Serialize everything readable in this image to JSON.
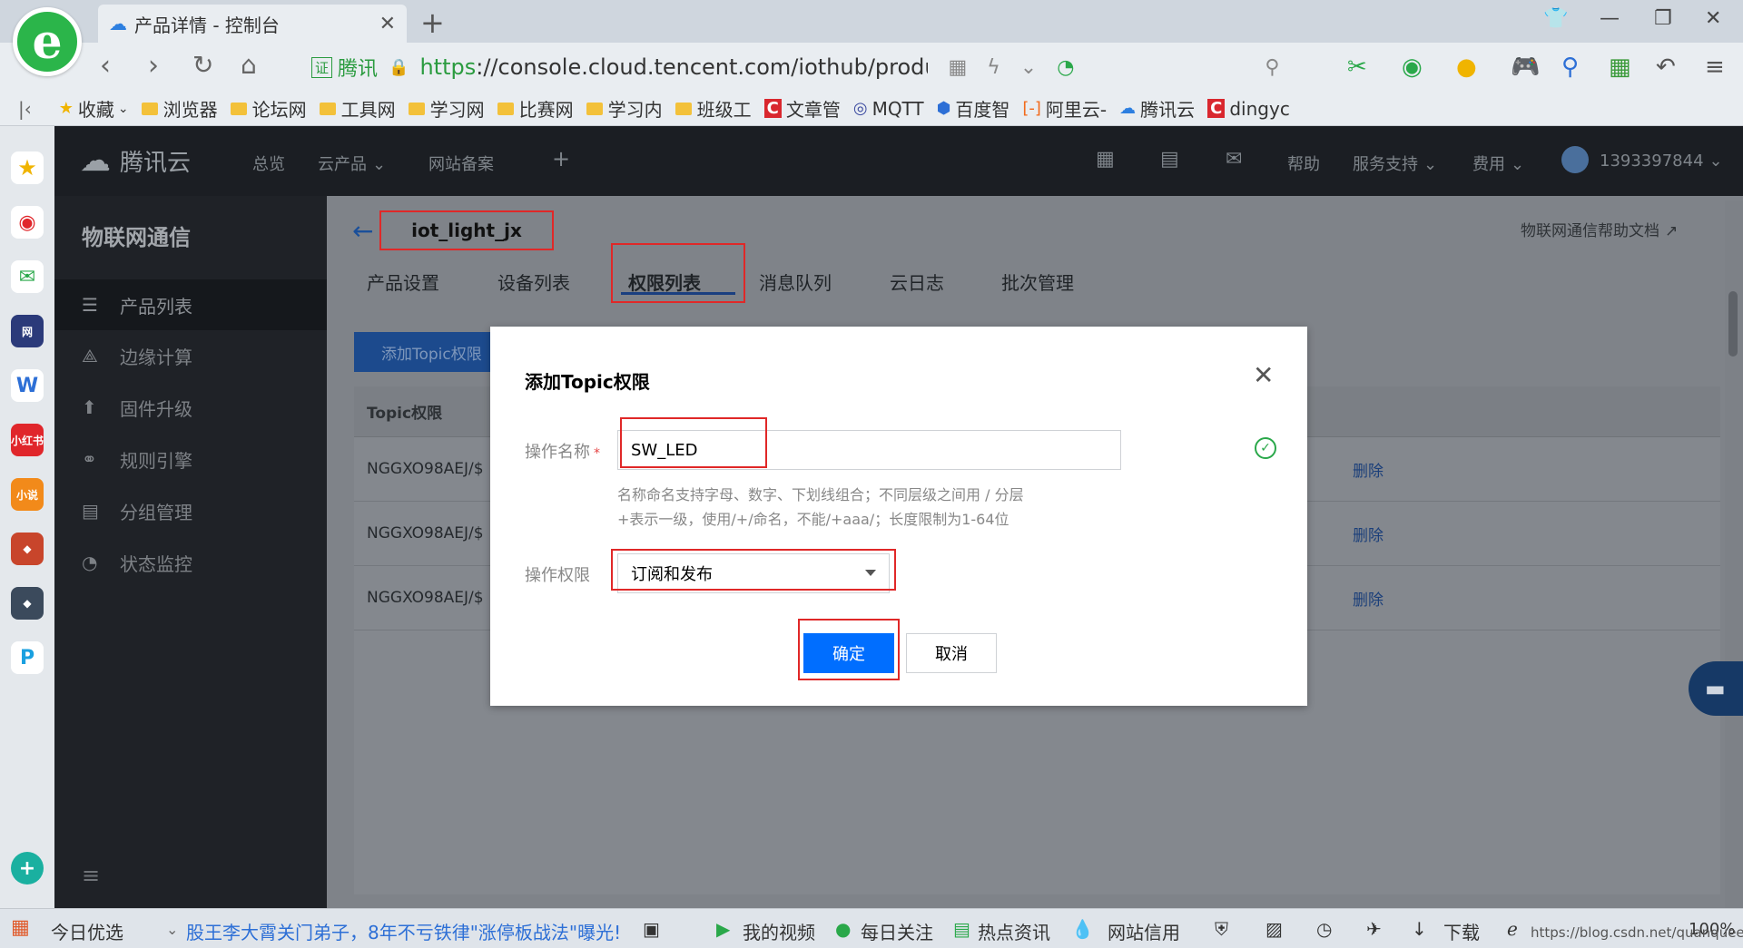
{
  "browser": {
    "tab_title": "产品详情 - 控制台",
    "address": {
      "site_label": "腾讯",
      "url_proto": "https",
      "url_rest": "://console.cloud.tencent.com/iothub/product/NG"
    },
    "bookmarks": [
      {
        "label": "收藏",
        "type": "star"
      },
      {
        "label": "浏览器",
        "type": "folder"
      },
      {
        "label": "论坛网",
        "type": "folder"
      },
      {
        "label": "工具网",
        "type": "folder"
      },
      {
        "label": "学习网",
        "type": "folder"
      },
      {
        "label": "比赛网",
        "type": "folder"
      },
      {
        "label": "学习内",
        "type": "folder"
      },
      {
        "label": "班级工",
        "type": "folder"
      },
      {
        "label": "文章管",
        "type": "csdn"
      },
      {
        "label": "MQTT",
        "type": "mqtt"
      },
      {
        "label": "百度智",
        "type": "baidu"
      },
      {
        "label": "阿里云-",
        "type": "aliyun"
      },
      {
        "label": "腾讯云",
        "type": "tencent"
      },
      {
        "label": "dingyc",
        "type": "csdn"
      }
    ]
  },
  "console": {
    "brand": "腾讯云",
    "top_nav": {
      "overview": "总览",
      "products": "云产品",
      "beian": "网站备案",
      "help": "帮助",
      "support": "服务支持",
      "billing": "费用",
      "user": "1393397844"
    },
    "sidebar": {
      "title": "物联网通信",
      "items": [
        {
          "label": "产品列表",
          "icon": "list-icon"
        },
        {
          "label": "边缘计算",
          "icon": "edge-icon"
        },
        {
          "label": "固件升级",
          "icon": "upgrade-icon"
        },
        {
          "label": "规则引擎",
          "icon": "link-icon"
        },
        {
          "label": "分组管理",
          "icon": "group-icon"
        },
        {
          "label": "状态监控",
          "icon": "monitor-icon"
        }
      ]
    },
    "product_name": "iot_light_jx",
    "help_doc": "物联网通信帮助文档",
    "tabs": [
      "产品设置",
      "设备列表",
      "权限列表",
      "消息队列",
      "云日志",
      "批次管理"
    ],
    "active_tab": "权限列表",
    "add_button": "添加Topic权限",
    "table": {
      "header": "Topic权限",
      "rows": [
        {
          "topic": "NGGXO98AEJ/$",
          "action": "删除"
        },
        {
          "topic": "NGGXO98AEJ/$",
          "action": "删除"
        },
        {
          "topic": "NGGXO98AEJ/$",
          "action": "删除"
        }
      ]
    }
  },
  "modal": {
    "title": "添加Topic权限",
    "name_label": "操作名称",
    "name_value": "SW_LED",
    "hint_line1": "名称命名支持字母、数字、下划线组合；不同层级之间用 / 分层",
    "hint_line2": "+表示一级，使用/+/命名，不能/+aaa/；长度限制为1-64位",
    "perm_label": "操作权限",
    "perm_value": "订阅和发布",
    "confirm": "确定",
    "cancel": "取消"
  },
  "statusbar": {
    "today": "今日优选",
    "news": "股王李大霄关门弟子，8年不亏铁律\"涨停板战法\"曝光!",
    "video": "我的视频",
    "daily": "每日关注",
    "hot": "热点资讯",
    "credit": "网站信用",
    "download": "下载",
    "zoom": "100%",
    "watermark": "https://blog.csdn.net/quanqueen"
  }
}
